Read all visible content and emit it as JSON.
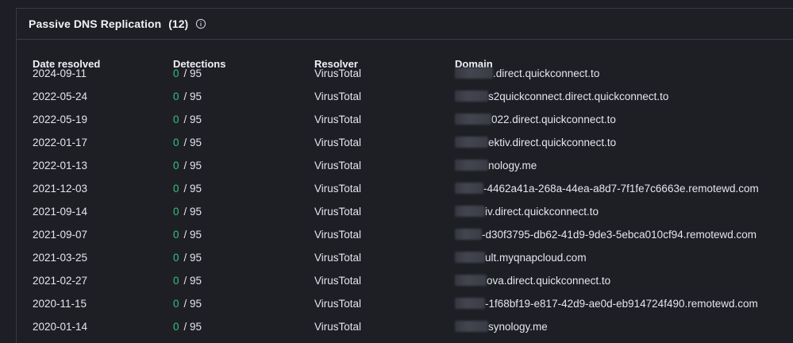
{
  "panel": {
    "title": "Passive DNS Replication",
    "count": "(12)",
    "info_icon": "info-circle-icon"
  },
  "columns": {
    "date": "Date resolved",
    "detections": "Detections",
    "resolver": "Resolver",
    "domain": "Domain"
  },
  "colors": {
    "background": "#1e1f25",
    "border": "#3a3c49",
    "detections_zero": "#33c27a",
    "text": "#e4e6ee"
  },
  "rows": [
    {
      "date": "2024-09-11",
      "positives": "0",
      "total": "/ 95",
      "resolver": "VirusTotal",
      "domain": ".direct.quickconnect.to"
    },
    {
      "date": "2022-05-24",
      "positives": "0",
      "total": "/ 95",
      "resolver": "VirusTotal",
      "domain": "s2quickconnect.direct.quickconnect.to"
    },
    {
      "date": "2022-05-19",
      "positives": "0",
      "total": "/ 95",
      "resolver": "VirusTotal",
      "domain": "022.direct.quickconnect.to"
    },
    {
      "date": "2022-01-17",
      "positives": "0",
      "total": "/ 95",
      "resolver": "VirusTotal",
      "domain": "ektiv.direct.quickconnect.to"
    },
    {
      "date": "2022-01-13",
      "positives": "0",
      "total": "/ 95",
      "resolver": "VirusTotal",
      "domain": "nology.me"
    },
    {
      "date": "2021-12-03",
      "positives": "0",
      "total": "/ 95",
      "resolver": "VirusTotal",
      "domain": "-4462a41a-268a-44ea-a8d7-7f1fe7c6663e.remotewd.com"
    },
    {
      "date": "2021-09-14",
      "positives": "0",
      "total": "/ 95",
      "resolver": "VirusTotal",
      "domain": "iv.direct.quickconnect.to"
    },
    {
      "date": "2021-09-07",
      "positives": "0",
      "total": "/ 95",
      "resolver": "VirusTotal",
      "domain": "-d30f3795-db62-41d9-9de3-5ebca010cf94.remotewd.com"
    },
    {
      "date": "2021-03-25",
      "positives": "0",
      "total": "/ 95",
      "resolver": "VirusTotal",
      "domain": "ult.myqnapcloud.com"
    },
    {
      "date": "2021-02-27",
      "positives": "0",
      "total": "/ 95",
      "resolver": "VirusTotal",
      "domain": "ova.direct.quickconnect.to"
    },
    {
      "date": "2020-11-15",
      "positives": "0",
      "total": "/ 95",
      "resolver": "VirusTotal",
      "domain": "-1f68bf19-e817-42d9-ae0d-eb914724f490.remotewd.com"
    },
    {
      "date": "2020-01-14",
      "positives": "0",
      "total": "/ 95",
      "resolver": "VirusTotal",
      "domain": "synology.me"
    }
  ]
}
